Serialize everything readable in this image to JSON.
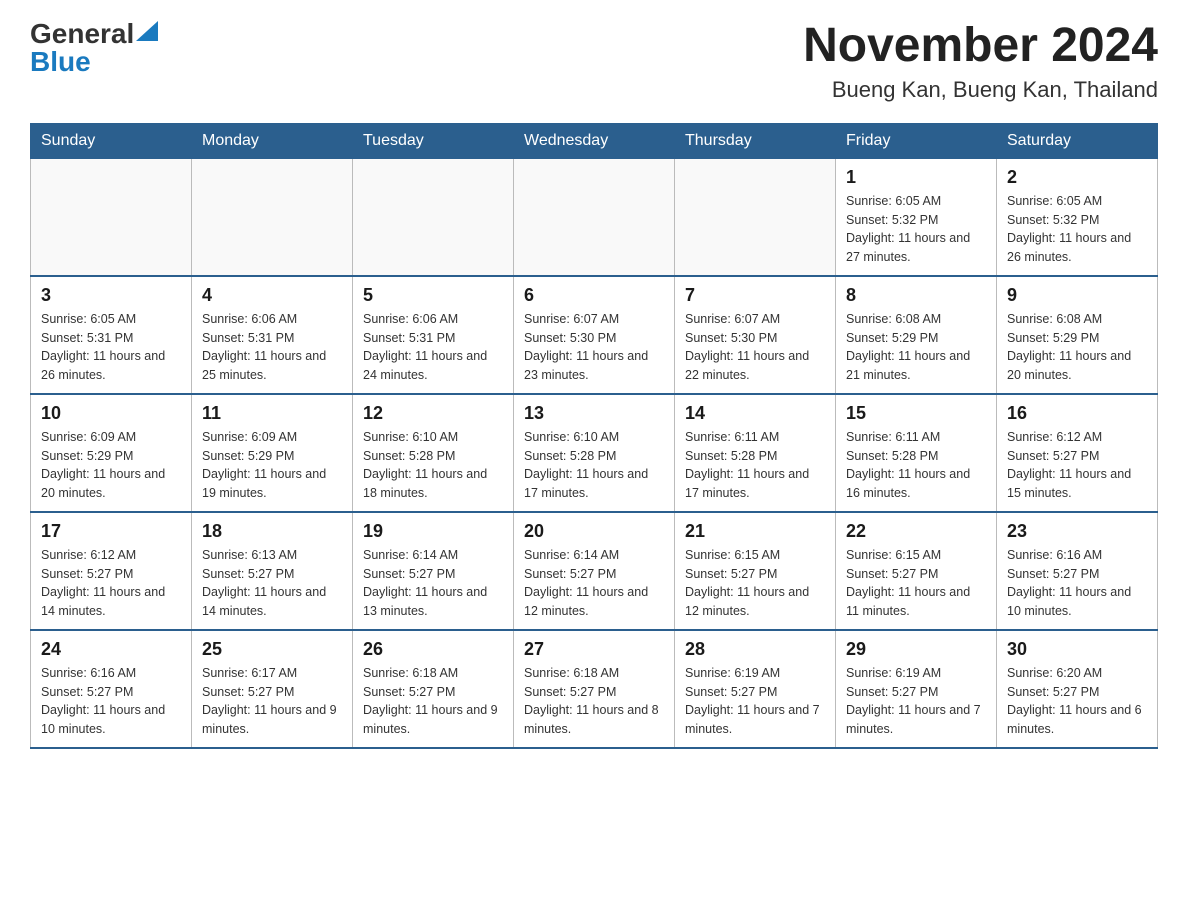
{
  "logo": {
    "general": "General",
    "blue": "Blue",
    "triangle": "▲"
  },
  "title": "November 2024",
  "location": "Bueng Kan, Bueng Kan, Thailand",
  "weekdays": [
    "Sunday",
    "Monday",
    "Tuesday",
    "Wednesday",
    "Thursday",
    "Friday",
    "Saturday"
  ],
  "weeks": [
    [
      {
        "day": "",
        "info": ""
      },
      {
        "day": "",
        "info": ""
      },
      {
        "day": "",
        "info": ""
      },
      {
        "day": "",
        "info": ""
      },
      {
        "day": "",
        "info": ""
      },
      {
        "day": "1",
        "info": "Sunrise: 6:05 AM\nSunset: 5:32 PM\nDaylight: 11 hours and 27 minutes."
      },
      {
        "day": "2",
        "info": "Sunrise: 6:05 AM\nSunset: 5:32 PM\nDaylight: 11 hours and 26 minutes."
      }
    ],
    [
      {
        "day": "3",
        "info": "Sunrise: 6:05 AM\nSunset: 5:31 PM\nDaylight: 11 hours and 26 minutes."
      },
      {
        "day": "4",
        "info": "Sunrise: 6:06 AM\nSunset: 5:31 PM\nDaylight: 11 hours and 25 minutes."
      },
      {
        "day": "5",
        "info": "Sunrise: 6:06 AM\nSunset: 5:31 PM\nDaylight: 11 hours and 24 minutes."
      },
      {
        "day": "6",
        "info": "Sunrise: 6:07 AM\nSunset: 5:30 PM\nDaylight: 11 hours and 23 minutes."
      },
      {
        "day": "7",
        "info": "Sunrise: 6:07 AM\nSunset: 5:30 PM\nDaylight: 11 hours and 22 minutes."
      },
      {
        "day": "8",
        "info": "Sunrise: 6:08 AM\nSunset: 5:29 PM\nDaylight: 11 hours and 21 minutes."
      },
      {
        "day": "9",
        "info": "Sunrise: 6:08 AM\nSunset: 5:29 PM\nDaylight: 11 hours and 20 minutes."
      }
    ],
    [
      {
        "day": "10",
        "info": "Sunrise: 6:09 AM\nSunset: 5:29 PM\nDaylight: 11 hours and 20 minutes."
      },
      {
        "day": "11",
        "info": "Sunrise: 6:09 AM\nSunset: 5:29 PM\nDaylight: 11 hours and 19 minutes."
      },
      {
        "day": "12",
        "info": "Sunrise: 6:10 AM\nSunset: 5:28 PM\nDaylight: 11 hours and 18 minutes."
      },
      {
        "day": "13",
        "info": "Sunrise: 6:10 AM\nSunset: 5:28 PM\nDaylight: 11 hours and 17 minutes."
      },
      {
        "day": "14",
        "info": "Sunrise: 6:11 AM\nSunset: 5:28 PM\nDaylight: 11 hours and 17 minutes."
      },
      {
        "day": "15",
        "info": "Sunrise: 6:11 AM\nSunset: 5:28 PM\nDaylight: 11 hours and 16 minutes."
      },
      {
        "day": "16",
        "info": "Sunrise: 6:12 AM\nSunset: 5:27 PM\nDaylight: 11 hours and 15 minutes."
      }
    ],
    [
      {
        "day": "17",
        "info": "Sunrise: 6:12 AM\nSunset: 5:27 PM\nDaylight: 11 hours and 14 minutes."
      },
      {
        "day": "18",
        "info": "Sunrise: 6:13 AM\nSunset: 5:27 PM\nDaylight: 11 hours and 14 minutes."
      },
      {
        "day": "19",
        "info": "Sunrise: 6:14 AM\nSunset: 5:27 PM\nDaylight: 11 hours and 13 minutes."
      },
      {
        "day": "20",
        "info": "Sunrise: 6:14 AM\nSunset: 5:27 PM\nDaylight: 11 hours and 12 minutes."
      },
      {
        "day": "21",
        "info": "Sunrise: 6:15 AM\nSunset: 5:27 PM\nDaylight: 11 hours and 12 minutes."
      },
      {
        "day": "22",
        "info": "Sunrise: 6:15 AM\nSunset: 5:27 PM\nDaylight: 11 hours and 11 minutes."
      },
      {
        "day": "23",
        "info": "Sunrise: 6:16 AM\nSunset: 5:27 PM\nDaylight: 11 hours and 10 minutes."
      }
    ],
    [
      {
        "day": "24",
        "info": "Sunrise: 6:16 AM\nSunset: 5:27 PM\nDaylight: 11 hours and 10 minutes."
      },
      {
        "day": "25",
        "info": "Sunrise: 6:17 AM\nSunset: 5:27 PM\nDaylight: 11 hours and 9 minutes."
      },
      {
        "day": "26",
        "info": "Sunrise: 6:18 AM\nSunset: 5:27 PM\nDaylight: 11 hours and 9 minutes."
      },
      {
        "day": "27",
        "info": "Sunrise: 6:18 AM\nSunset: 5:27 PM\nDaylight: 11 hours and 8 minutes."
      },
      {
        "day": "28",
        "info": "Sunrise: 6:19 AM\nSunset: 5:27 PM\nDaylight: 11 hours and 7 minutes."
      },
      {
        "day": "29",
        "info": "Sunrise: 6:19 AM\nSunset: 5:27 PM\nDaylight: 11 hours and 7 minutes."
      },
      {
        "day": "30",
        "info": "Sunrise: 6:20 AM\nSunset: 5:27 PM\nDaylight: 11 hours and 6 minutes."
      }
    ]
  ]
}
